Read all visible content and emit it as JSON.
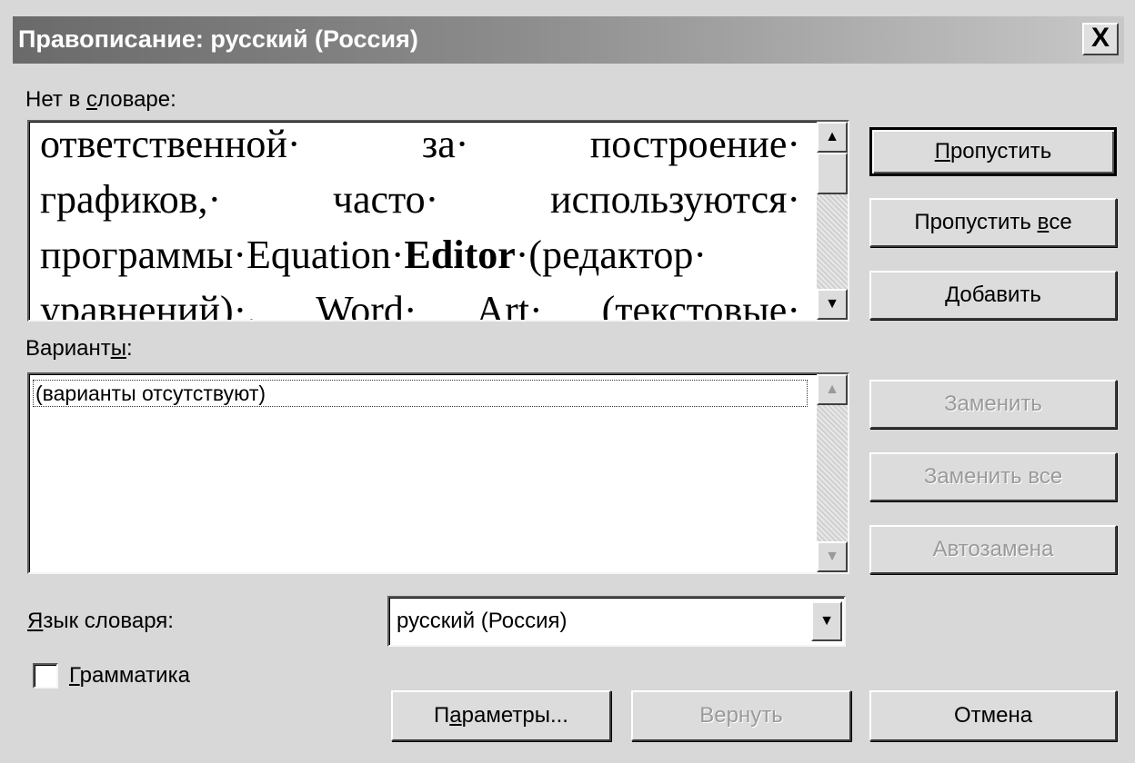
{
  "window": {
    "title": "Правописание: русский (Россия)",
    "close_glyph": "X"
  },
  "not_in_dict": {
    "label_pre": "Нет в ",
    "label_acc": "с",
    "label_post": "ловаре:",
    "text_lines": [
      [
        "ответственной·",
        "за·",
        "построение·"
      ],
      [
        "графиков,·",
        "часто·",
        "используются·"
      ],
      [
        "программы·Equation·",
        "Editor",
        "·(редактор·"
      ],
      [
        "уравнений)·,",
        "Word·",
        "Art·",
        "(текстовые·"
      ]
    ]
  },
  "suggestions": {
    "label_pre": "Вариант",
    "label_acc": "ы",
    "label_post": ":",
    "items": [
      "(варианты отсутствуют)"
    ]
  },
  "language": {
    "label_acc": "Я",
    "label_post": "зык словаря:",
    "value": "русский (Россия)"
  },
  "grammar": {
    "label_acc": "Г",
    "label_post": "рамматика",
    "checked": false
  },
  "buttons": {
    "ignore": {
      "pre": "",
      "acc": "П",
      "post": "ропустить"
    },
    "ignore_all": {
      "pre": "Пропустить ",
      "acc": "в",
      "post": "се"
    },
    "add": {
      "pre": "",
      "acc": "Д",
      "post": "обавить"
    },
    "change": "Заменить",
    "change_all": "Заменить все",
    "autocorrect": "Автозамена",
    "options": {
      "pre": "П",
      "acc": "а",
      "post": "раметры..."
    },
    "undo": "Вернуть",
    "cancel": "Отмена"
  },
  "icons": {
    "scroll_up": "▲",
    "scroll_down": "▼",
    "dropdown": "▼"
  }
}
